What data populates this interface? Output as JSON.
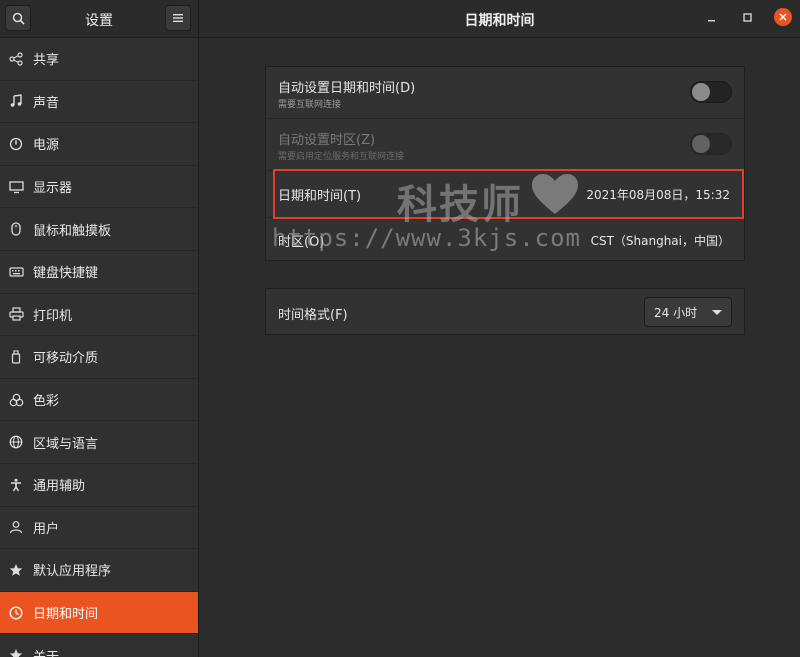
{
  "header": {
    "sidebar_title": "设置",
    "main_title": "日期和时间"
  },
  "sidebar": {
    "items": [
      {
        "label": "共享",
        "icon": "share-icon"
      },
      {
        "label": "声音",
        "icon": "music-note-icon"
      },
      {
        "label": "电源",
        "icon": "power-icon"
      },
      {
        "label": "显示器",
        "icon": "display-icon"
      },
      {
        "label": "鼠标和触摸板",
        "icon": "mouse-icon"
      },
      {
        "label": "键盘快捷键",
        "icon": "keyboard-icon"
      },
      {
        "label": "打印机",
        "icon": "printer-icon"
      },
      {
        "label": "可移动介质",
        "icon": "removable-media-icon"
      },
      {
        "label": "色彩",
        "icon": "color-icon"
      },
      {
        "label": "区域与语言",
        "icon": "globe-icon"
      },
      {
        "label": "通用辅助",
        "icon": "accessibility-icon"
      },
      {
        "label": "用户",
        "icon": "user-icon"
      },
      {
        "label": "默认应用程序",
        "icon": "star-icon"
      },
      {
        "label": "日期和时间",
        "icon": "clock-icon",
        "active": true
      },
      {
        "label": "关于",
        "icon": "info-icon"
      }
    ]
  },
  "datetime": {
    "auto_datetime_label": "自动设置日期和时间(D)",
    "auto_datetime_sub": "需要互联网连接",
    "auto_datetime_on": false,
    "auto_tz_label": "自动设置时区(Z)",
    "auto_tz_sub": "需要启用定位服务和互联网连接",
    "auto_tz_on": false,
    "datetime_label": "日期和时间(T)",
    "datetime_value": "2021年08月08日，15:32",
    "timezone_label": "时区(O)",
    "timezone_value": "CST（Shanghai，中国）"
  },
  "time_format": {
    "label": "时间格式(F)",
    "selected": "24 小时"
  },
  "watermark": {
    "text1": "科技师",
    "text2": "https://www.3kjs.com"
  },
  "colors": {
    "accent": "#e95420",
    "highlight_border": "#e0402a"
  }
}
